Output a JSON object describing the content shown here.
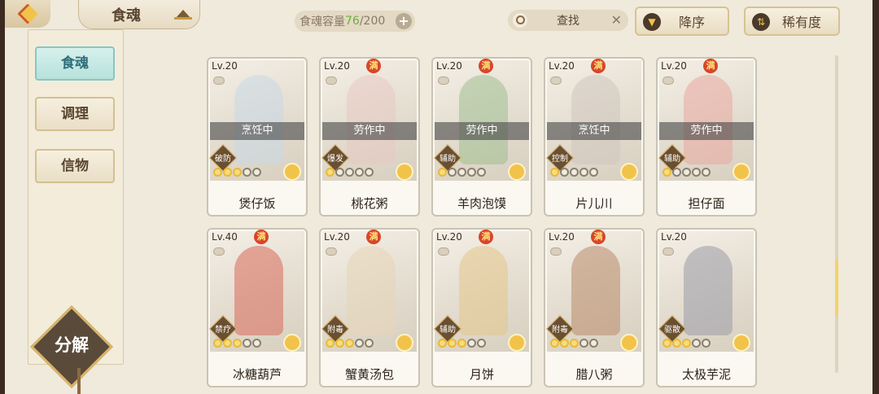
{
  "header": {
    "title": "食魂",
    "capacity_label": "食魂容量",
    "capacity_current": "76",
    "capacity_max": "/200",
    "search_label": "查找",
    "sort_order_label": "降序",
    "sort_rarity_label": "稀有度"
  },
  "sidebar": {
    "items": [
      {
        "label": "食魂",
        "active": true
      },
      {
        "label": "调理",
        "active": false
      },
      {
        "label": "信物",
        "active": false
      }
    ],
    "decompose_label": "分解"
  },
  "cards": [
    {
      "level": "Lv.20",
      "full": "",
      "status": "烹饪中",
      "role": "破防",
      "bonds": 3,
      "name": "煲仔饭",
      "tint": "#c9d9e6"
    },
    {
      "level": "Lv.20",
      "full": "满",
      "status": "劳作中",
      "role": "爆发",
      "bonds": 1,
      "name": "桃花粥",
      "tint": "#e8c9c2"
    },
    {
      "level": "Lv.20",
      "full": "满",
      "status": "劳作中",
      "role": "辅助",
      "bonds": 1,
      "name": "羊肉泡馍",
      "tint": "#9fbf8f"
    },
    {
      "level": "Lv.20",
      "full": "满",
      "status": "烹饪中",
      "role": "控制",
      "bonds": 1,
      "name": "片儿川",
      "tint": "#cfc7bd"
    },
    {
      "level": "Lv.20",
      "full": "满",
      "status": "劳作中",
      "role": "辅助",
      "bonds": 1,
      "name": "担仔面",
      "tint": "#e9a8a0"
    },
    {
      "level": "Lv.40",
      "full": "满",
      "status": "",
      "role": "禁疗",
      "bonds": 3,
      "name": "冰糖葫芦",
      "tint": "#d96a5a"
    },
    {
      "level": "Lv.20",
      "full": "满",
      "status": "",
      "role": "附毒",
      "bonds": 3,
      "name": "蟹黄汤包",
      "tint": "#e7d6b8"
    },
    {
      "level": "Lv.20",
      "full": "满",
      "status": "",
      "role": "辅助",
      "bonds": 3,
      "name": "月饼",
      "tint": "#e3c68a"
    },
    {
      "level": "Lv.20",
      "full": "满",
      "status": "",
      "role": "附毒",
      "bonds": 3,
      "name": "腊八粥",
      "tint": "#b98a6a"
    },
    {
      "level": "Lv.20",
      "full": "",
      "status": "",
      "role": "驱散",
      "bonds": 3,
      "name": "太极芋泥",
      "tint": "#9a9aa8"
    }
  ],
  "icons": {
    "back": "chevron-left-icon",
    "hat": "hat-icon",
    "search": "magnifier-icon",
    "clear": "close-icon",
    "sort": "arrow-down-icon",
    "rarity": "sort-arrows-icon"
  },
  "colors": {
    "accent": "#f3c24a",
    "active_tab": "#b6e2dc",
    "capacity_current": "#6cae3a",
    "full_badge": "#d8452a"
  }
}
